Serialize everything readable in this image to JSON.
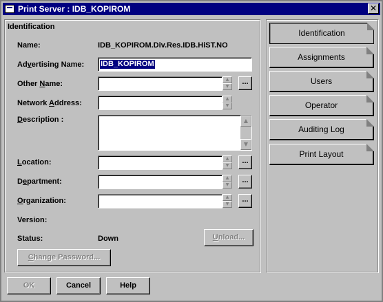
{
  "window": {
    "title": "Print Server : IDB_KOPIROM",
    "close_label": "✕"
  },
  "section_title": "Identification",
  "fields": {
    "name_label": "Name:",
    "name_value": "IDB_KOPIROM.Div.Res.IDB.HiST.NO",
    "advertising_label_pre": "Ad",
    "advertising_label_u": "v",
    "advertising_label_post": "ertising Name:",
    "advertising_value": "IDB_KOPIROM",
    "other_label_pre": "Other ",
    "other_label_u": "N",
    "other_label_post": "ame:",
    "network_label_pre": "Network ",
    "network_label_u": "A",
    "network_label_post": "ddress:",
    "description_label_pre": "",
    "description_label_u": "D",
    "description_label_post": "escription :",
    "location_label_pre": "",
    "location_label_u": "L",
    "location_label_post": "ocation:",
    "department_label_pre": "D",
    "department_label_u": "e",
    "department_label_post": "partment:",
    "organization_label_pre": "",
    "organization_label_u": "O",
    "organization_label_post": "rganization:",
    "version_label": "Version:",
    "status_label": "Status:",
    "status_value": "Down"
  },
  "buttons": {
    "browse": "...",
    "unload_u": "U",
    "unload_rest": "nload...",
    "change_password_u": "C",
    "change_password_rest": "hange Password...",
    "ok": "OK",
    "cancel": "Cancel",
    "help": "Help"
  },
  "tabs": [
    {
      "label": "Identification",
      "active": true
    },
    {
      "label": "Assignments",
      "active": false
    },
    {
      "label": "Users",
      "active": false
    },
    {
      "label": "Operator",
      "active": false
    },
    {
      "label": "Auditing Log",
      "active": false
    },
    {
      "label": "Print Layout",
      "active": false
    }
  ],
  "colors": {
    "face": "#c0c0c0",
    "titlebar": "#000080",
    "selection": "#000080",
    "disabled_text": "#808080"
  },
  "icons": {
    "spin_up": "▲",
    "spin_down": "▼",
    "scroll_up": "▲",
    "scroll_down": "▼"
  }
}
